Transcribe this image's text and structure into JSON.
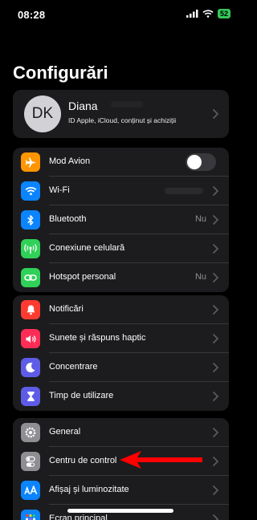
{
  "status_bar": {
    "time": "08:28",
    "battery": "52"
  },
  "page_title": "Configurări",
  "profile": {
    "initials": "DK",
    "name": "Diana",
    "subtitle": "ID Apple, iCloud, conținut și achiziții"
  },
  "group1": [
    {
      "label": "Mod Avion",
      "icon": "airplane-icon",
      "color": "#ff9500",
      "toggle": false
    },
    {
      "label": "Wi-Fi",
      "icon": "wifi-icon",
      "color": "#0a84ff",
      "value": ""
    },
    {
      "label": "Bluetooth",
      "icon": "bluetooth-icon",
      "color": "#0a84ff",
      "value": "Nu"
    },
    {
      "label": "Conexiune celulară",
      "icon": "antenna-icon",
      "color": "#30d158"
    },
    {
      "label": "Hotspot personal",
      "icon": "hotspot-icon",
      "color": "#30d158",
      "value": "Nu"
    }
  ],
  "group2": [
    {
      "label": "Notificări",
      "icon": "bell-icon",
      "color": "#ff3b30"
    },
    {
      "label": "Sunete și răspuns haptic",
      "icon": "speaker-icon",
      "color": "#ff2d55"
    },
    {
      "label": "Concentrare",
      "icon": "moon-icon",
      "color": "#5e5ce6"
    },
    {
      "label": "Timp de utilizare",
      "icon": "hourglass-icon",
      "color": "#5e5ce6"
    }
  ],
  "group3": [
    {
      "label": "General",
      "icon": "gear-icon",
      "color": "#8e8e93"
    },
    {
      "label": "Centru de control",
      "icon": "toggles-icon",
      "color": "#8e8e93"
    },
    {
      "label": "Afișaj și luminozitate",
      "icon": "text-size-icon",
      "color": "#0a84ff"
    },
    {
      "label": "Ecran principal",
      "icon": "home-grid-icon",
      "color": "#0a84ff"
    }
  ],
  "annotation": {
    "arrow_color": "#ff0000"
  }
}
